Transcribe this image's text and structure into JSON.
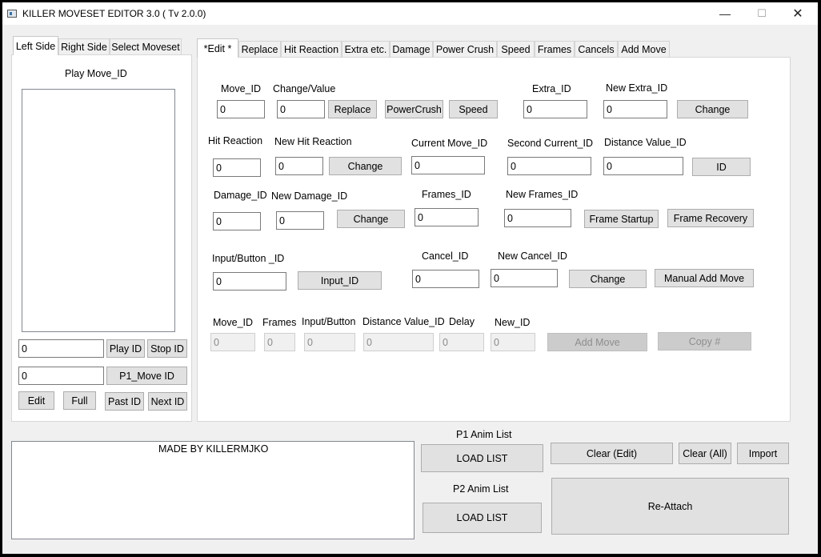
{
  "window": {
    "title": "KILLER MOVESET EDITOR 3.0  ( Tv 2.0.0)",
    "minimize": "—",
    "maximize": "☐",
    "close": "✕"
  },
  "left_tabs": [
    "Left Side",
    "Right Side",
    "Select Moveset"
  ],
  "left": {
    "play_move_label": "Play Move_ID",
    "play_input": "0",
    "play_id": "Play ID",
    "stop_id": "Stop ID",
    "p1_input": "0",
    "p1_move_id": "P1_Move ID",
    "edit": "Edit",
    "full": "Full",
    "past_id": "Past ID",
    "next_id": "Next ID"
  },
  "main_tabs": [
    "*Edit *",
    "Replace",
    "Hit Reaction",
    "Extra etc.",
    "Damage",
    "Power Crush",
    "Speed",
    "Frames",
    "Cancels",
    "Add Move"
  ],
  "edit": {
    "move_id_label": "Move_ID",
    "move_id_value": "0",
    "change_value_label": "Change/Value",
    "change_value_value": "0",
    "replace": "Replace",
    "powercrush": "PowerCrush",
    "speed": "Speed",
    "extra_id_label": "Extra_ID",
    "extra_id_value": "0",
    "new_extra_id_label": "New Extra_ID",
    "new_extra_id_value": "0",
    "change_extra": "Change",
    "hit_reaction_label": "Hit Reaction",
    "hit_reaction_value": "0",
    "new_hit_reaction_label": "New Hit Reaction",
    "new_hit_reaction_value": "0",
    "change_hit": "Change",
    "current_move_label": "Current Move_ID",
    "current_move_value": "0",
    "second_current_label": "Second Current_ID",
    "second_current_value": "0",
    "distance_value_label": "Distance Value_ID",
    "distance_value_value": "0",
    "id_button": "ID",
    "damage_id_label": "Damage_ID",
    "damage_id_value": "0",
    "new_damage_label": "New Damage_ID",
    "new_damage_value": "0",
    "change_damage": "Change",
    "frames_id_label": "Frames_ID",
    "frames_id_value": "0",
    "new_frames_label": "New Frames_ID",
    "new_frames_value": "0",
    "frame_startup": "Frame Startup",
    "frame_recovery": "Frame Recovery",
    "input_button_label": "Input/Button _ID",
    "input_button_value": "0",
    "input_id_button": "Input_ID",
    "cancel_id_label": "Cancel_ID",
    "cancel_id_value": "0",
    "new_cancel_label": "New Cancel_ID",
    "new_cancel_value": "0",
    "change_cancel": "Change",
    "manual_add_move": "Manual Add Move"
  },
  "add_move": {
    "move_id_label": "Move_ID",
    "move_id_value": "0",
    "frames_label": "Frames",
    "frames_value": "0",
    "input_button_label": "Input/Button",
    "input_button_value": "0",
    "distance_label": "Distance Value_ID",
    "distance_value": "0",
    "delay_label": "Delay",
    "delay_value": "0",
    "new_id_label": "New_ID",
    "new_id_value": "0",
    "add_move_button": "Add Move",
    "copy_button": "Copy #"
  },
  "bottom": {
    "credits": "MADE BY KILLERMJKO",
    "p1_anim_label": "P1 Anim List",
    "p1_load": "LOAD LIST",
    "p2_anim_label": "P2 Anim List",
    "p2_load": "LOAD LIST",
    "clear_edit": "Clear (Edit)",
    "clear_all": "Clear (All)",
    "import": "Import",
    "reattach": "Re-Attach"
  }
}
